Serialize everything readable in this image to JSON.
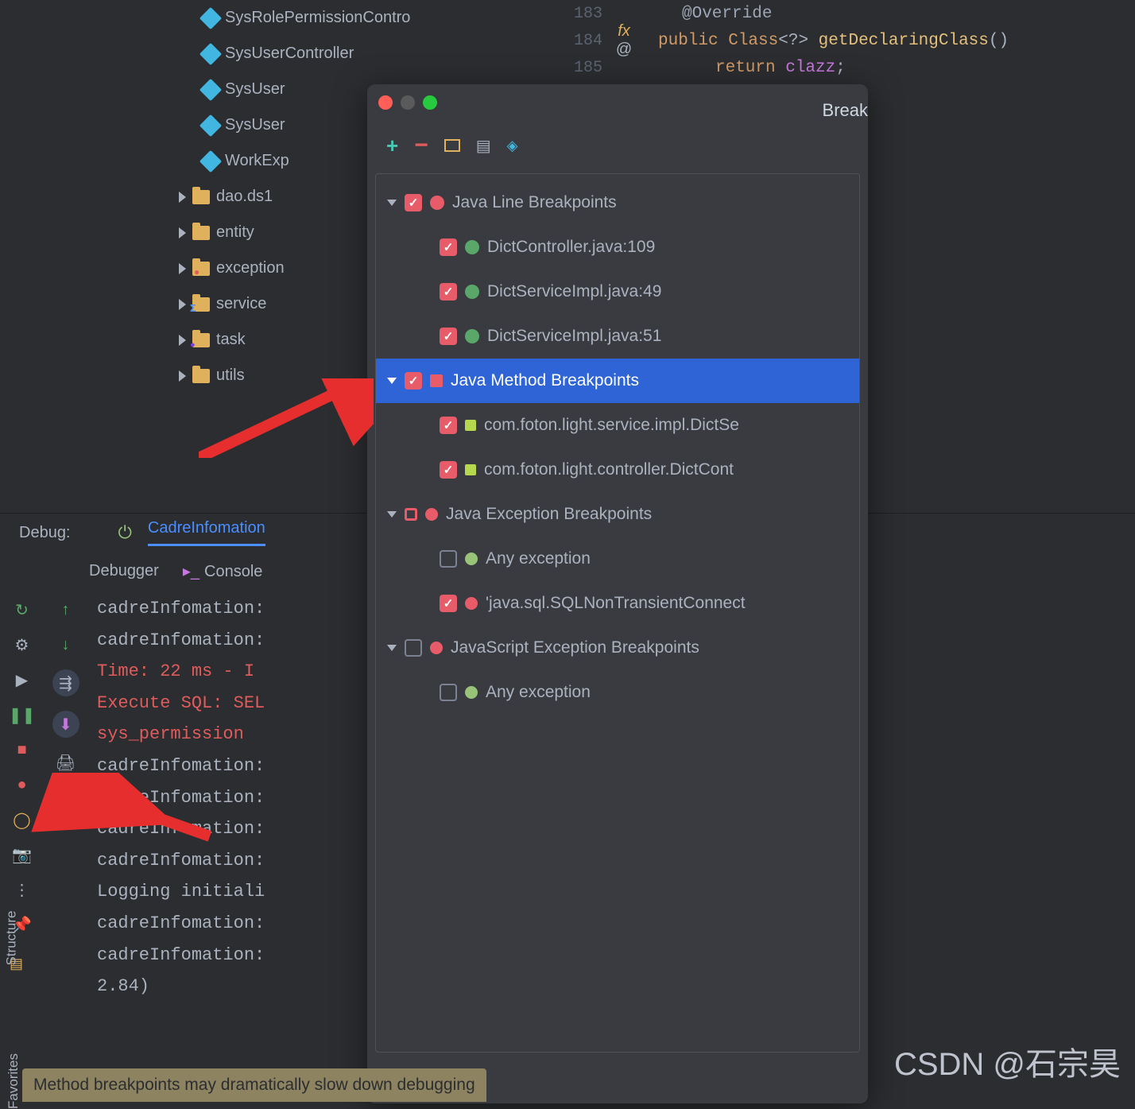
{
  "project": {
    "classes": [
      "SysRolePermissionContro",
      "SysUserController",
      "SysUser",
      "SysUser",
      "WorkExp"
    ],
    "dirs": [
      "dao.ds1",
      "entity",
      "exception",
      "service",
      "task",
      "utils"
    ]
  },
  "editor": {
    "lines": [
      {
        "no": "183",
        "code": "@Override",
        "cls": "ann"
      },
      {
        "no": "184",
        "code_parts": [
          {
            "t": "public ",
            "c": "kw"
          },
          {
            "t": "Class",
            "c": "ty"
          },
          {
            "t": "<?> ",
            "c": "pun"
          },
          {
            "t": "getDeclaringClass",
            "c": "fn"
          },
          {
            "t": "()",
            "c": "pun"
          }
        ],
        "gutter_icon": "fx @"
      },
      {
        "no": "185",
        "code_parts": [
          {
            "t": "return ",
            "c": "ret"
          },
          {
            "t": "clazz",
            "c": "fld"
          },
          {
            "t": ";",
            "c": "pun"
          }
        ]
      }
    ]
  },
  "debug": {
    "label": "Debug:",
    "config": "CadreInfomation",
    "tabs": [
      "Debugger",
      "Console"
    ],
    "console": [
      {
        "txt": "cadreInfomation:",
        "cls": ""
      },
      {
        "txt": "cadreInfomation:",
        "cls": ""
      },
      {
        "txt": "  Time: 22 ms - I",
        "cls": "red-txt"
      },
      {
        "txt": "Execute SQL: SEL",
        "cls": "red-txt"
      },
      {
        "txt": "   sys_permission",
        "cls": "red-txt"
      },
      {
        "txt": "",
        "cls": ""
      },
      {
        "txt": "cadreInfomation:",
        "cls": ""
      },
      {
        "txt": "cadreInfomation:",
        "cls": ""
      },
      {
        "txt": "cadreInfomation:",
        "cls": ""
      },
      {
        "txt": "cadreInfomation:",
        "cls": ""
      },
      {
        "txt": "Logging initiali",
        "cls": ""
      },
      {
        "txt": "cadreInfomation:",
        "cls": ""
      },
      {
        "txt": "cadreInfomation:",
        "cls": ""
      },
      {
        "txt": " 2.84)",
        "cls": ""
      }
    ]
  },
  "popup": {
    "title": "Break",
    "groups": {
      "line_bp": "Java Line Breakpoints",
      "line_items": [
        "DictController.java:109",
        "DictServiceImpl.java:49",
        "DictServiceImpl.java:51"
      ],
      "method_bp": "Java Method Breakpoints",
      "method_items": [
        "com.foton.light.service.impl.DictSe",
        "com.foton.light.controller.DictCont"
      ],
      "exc_bp": "Java Exception Breakpoints",
      "exc_any": "Any exception",
      "exc_sql": "'java.sql.SQLNonTransientConnect",
      "js_exc": "JavaScript Exception Breakpoints",
      "js_any": "Any exception"
    }
  },
  "sidebar": {
    "structure": "Structure",
    "favorites": "Favorites"
  },
  "status_bar": "Method breakpoints may dramatically slow down debugging",
  "watermark": "CSDN @石宗昊"
}
